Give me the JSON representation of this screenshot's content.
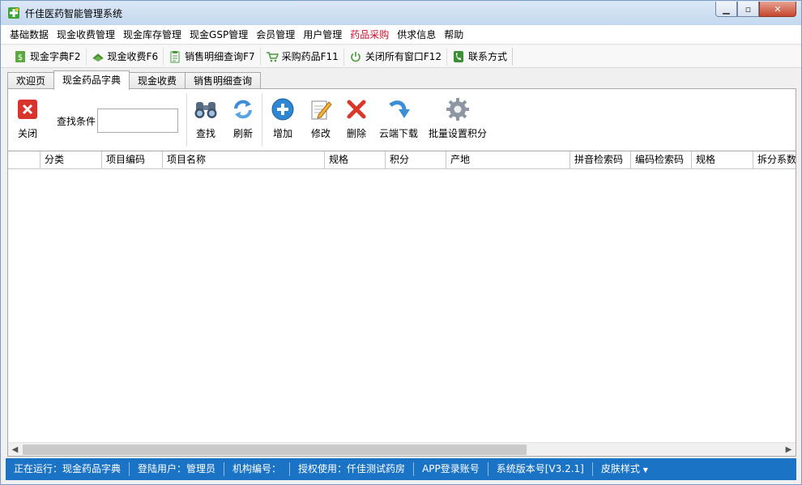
{
  "window": {
    "title": "仟佳医药智能管理系统"
  },
  "menu": {
    "items": [
      {
        "label": "基础数据"
      },
      {
        "label": "现金收费管理"
      },
      {
        "label": "现金库存管理"
      },
      {
        "label": "现金GSP管理"
      },
      {
        "label": "会员管理"
      },
      {
        "label": "用户管理"
      },
      {
        "label": "药品采购",
        "highlight": true
      },
      {
        "label": "供求信息"
      },
      {
        "label": "帮助"
      }
    ],
    "highlight_color": "#c8102e"
  },
  "quickbar": {
    "items": [
      {
        "label": "现金字典F2",
        "icon": "dictionary-icon"
      },
      {
        "label": "现金收费F6",
        "icon": "cash-register-icon"
      },
      {
        "label": "销售明细查询F7",
        "icon": "clipboard-icon"
      },
      {
        "label": "采购药品F11",
        "icon": "cart-icon"
      },
      {
        "label": "关闭所有窗口F12",
        "icon": "power-icon"
      },
      {
        "label": "联系方式",
        "icon": "phone-icon"
      }
    ]
  },
  "tabs": [
    {
      "label": "欢迎页"
    },
    {
      "label": "现金药品字典",
      "active": true
    },
    {
      "label": "现金收费"
    },
    {
      "label": "销售明细查询"
    }
  ],
  "toolbar": {
    "close_label": "关闭",
    "search_label": "查找条件",
    "search_value": "",
    "find_label": "查找",
    "refresh_label": "刷新",
    "add_label": "增加",
    "edit_label": "修改",
    "delete_label": "删除",
    "download_label": "云端下载",
    "batch_points_label": "批量设置积分"
  },
  "grid": {
    "columns": [
      "",
      "分类",
      "项目编码",
      "项目名称",
      "规格",
      "积分",
      "产地",
      "拼音检索码",
      "编码检索码",
      "规格",
      "拆分系数"
    ],
    "rows": []
  },
  "statusbar": {
    "running": "正在运行：现金药品字典",
    "user": "登陆用户：管理员",
    "org": "机构编号：",
    "license": "授权使用：仟佳测试药房",
    "app_account": "APP登录账号",
    "version": "系统版本号[V3.2.1]",
    "skin": "皮肤样式",
    "color": "#1b73c6"
  }
}
